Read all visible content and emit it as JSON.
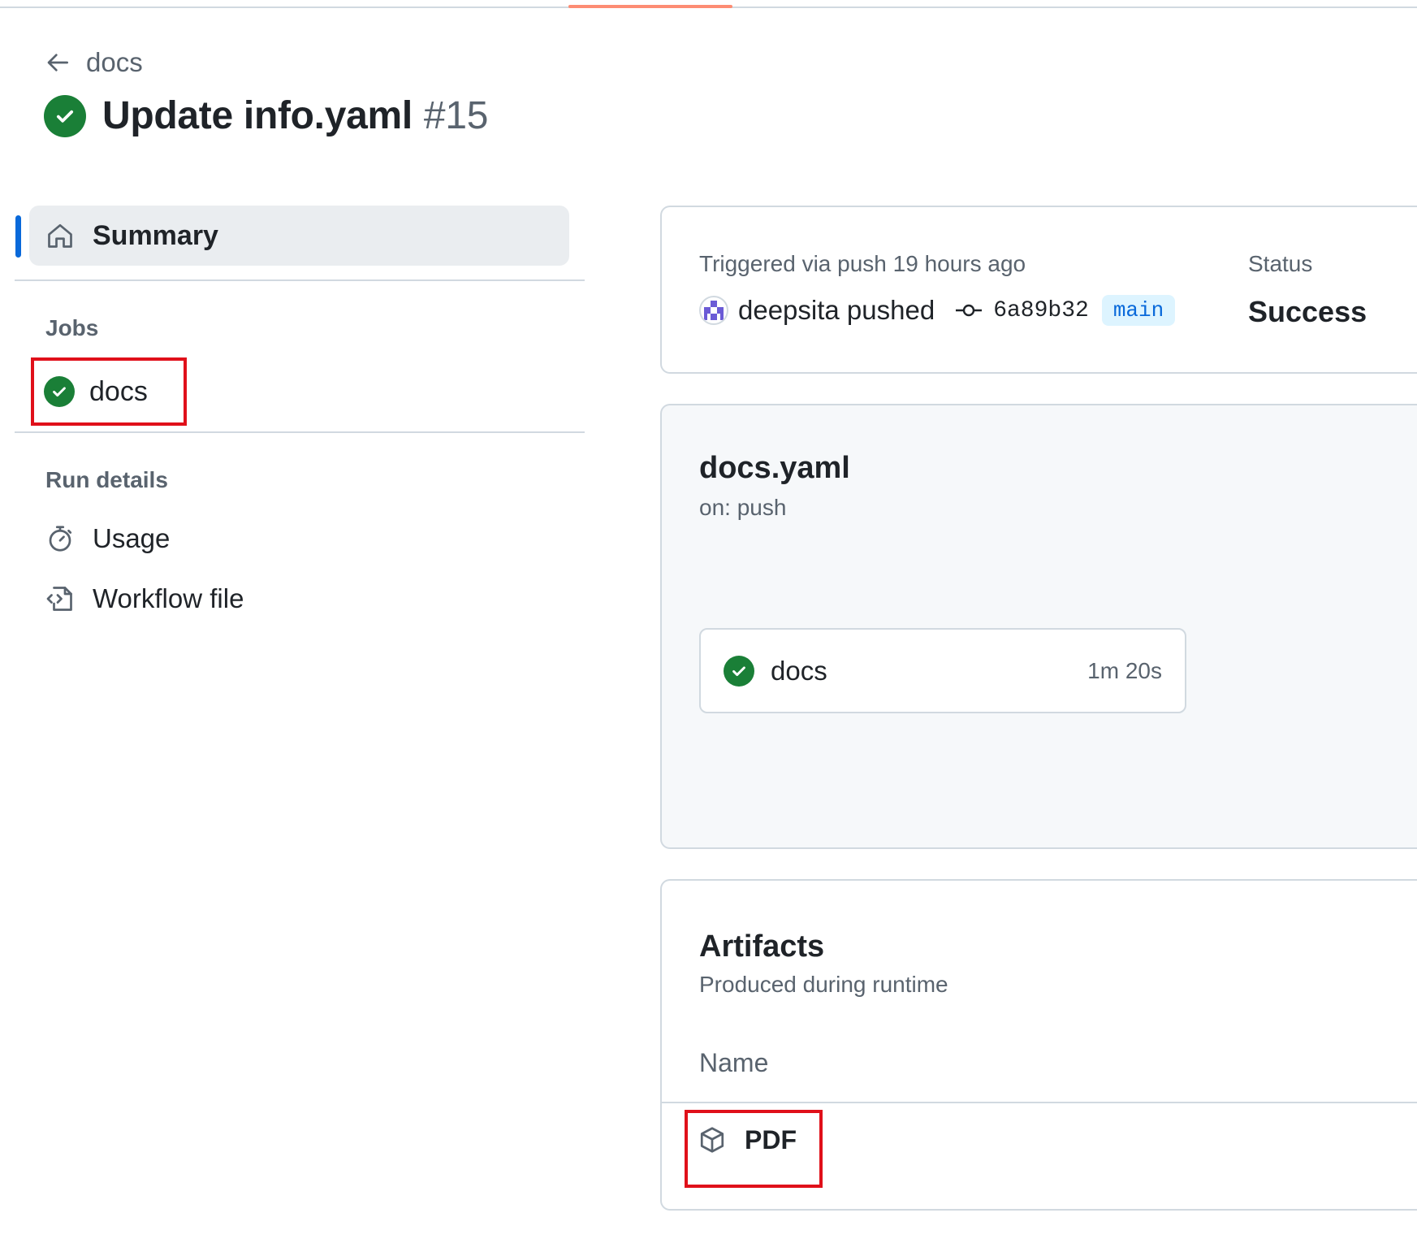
{
  "colors": {
    "accent": "#0969da",
    "success": "#1a7f37",
    "highlight_box": "#e0101a",
    "tab_underline": "#fd8c73"
  },
  "back": {
    "label": "docs",
    "icon": "arrow-left-icon"
  },
  "run": {
    "title": "Update info.yaml",
    "number": "#15",
    "status_icon": "check-circle-icon"
  },
  "sidebar": {
    "summary_label": "Summary",
    "jobs_heading": "Jobs",
    "jobs": [
      {
        "label": "docs",
        "status_icon": "check-circle-icon"
      }
    ],
    "run_details_heading": "Run details",
    "run_details": [
      {
        "label": "Usage",
        "icon": "stopwatch-icon"
      },
      {
        "label": "Workflow file",
        "icon": "file-code-icon"
      }
    ]
  },
  "trigger": {
    "label": "Triggered via push 19 hours ago",
    "actor": "deepsita pushed",
    "commit_sha": "6a89b32",
    "branch": "main",
    "status_label": "Status",
    "status_value": "Success"
  },
  "workflow": {
    "file": "docs.yaml",
    "on": "on: push",
    "jobs": [
      {
        "name": "docs",
        "duration": "1m 20s"
      }
    ]
  },
  "artifacts": {
    "title": "Artifacts",
    "subtitle": "Produced during runtime",
    "column_name": "Name",
    "items": [
      {
        "name": "PDF",
        "icon": "package-icon"
      }
    ]
  }
}
